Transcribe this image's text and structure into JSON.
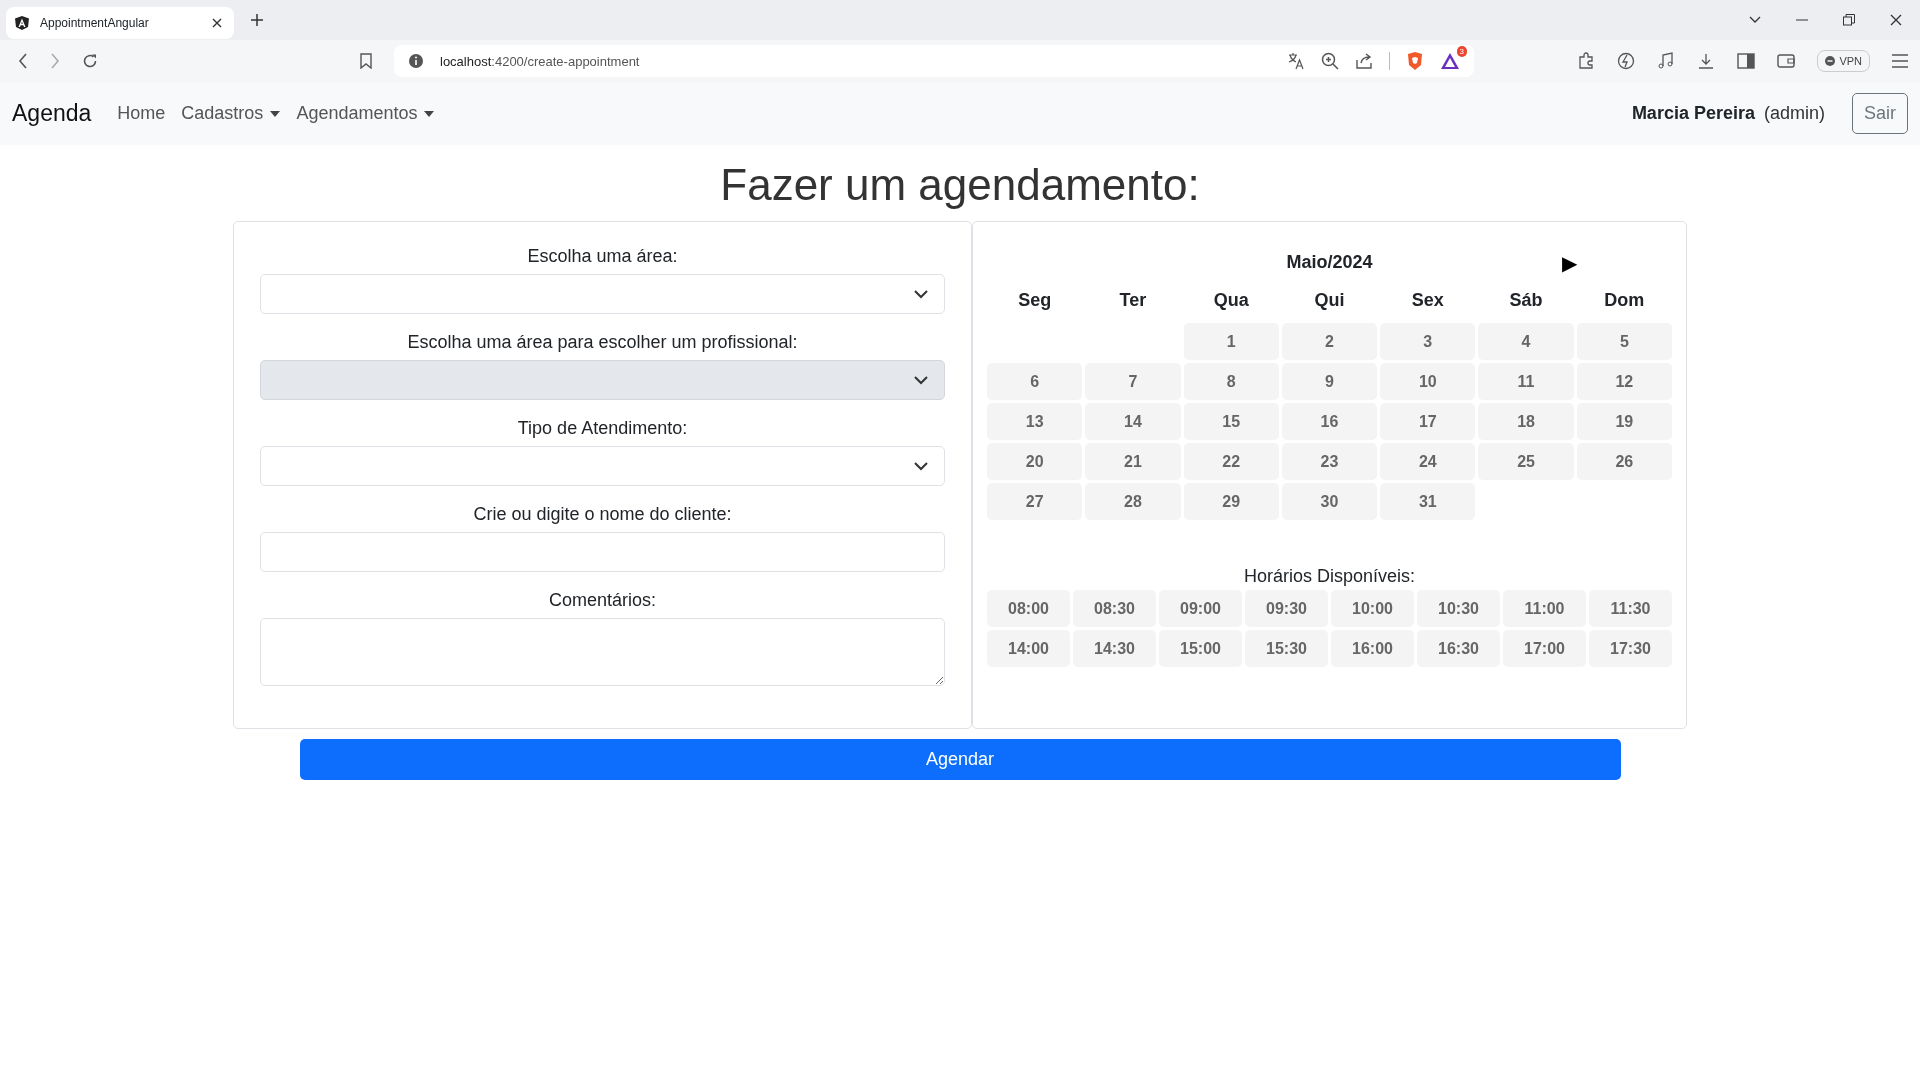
{
  "browser": {
    "tab_title": "AppointmentAngular",
    "url_host": "localhost",
    "url_rest": ":4200/create-appointment",
    "rewards_badge": "3",
    "vpn_label": "VPN"
  },
  "navbar": {
    "brand": "Agenda",
    "links": [
      {
        "label": "Home",
        "dropdown": false
      },
      {
        "label": "Cadastros",
        "dropdown": true
      },
      {
        "label": "Agendamentos",
        "dropdown": true
      }
    ],
    "user_name": "Marcia Pereira",
    "user_role": "(admin)",
    "logout": "Sair"
  },
  "title": "Fazer um agendamento:",
  "form": [
    {
      "kind": "select",
      "label": "Escolha uma área:",
      "disabled": false
    },
    {
      "kind": "select",
      "label": "Escolha uma área para escolher um profissional:",
      "disabled": true
    },
    {
      "kind": "select",
      "label": "Tipo de Atendimento:",
      "disabled": false
    },
    {
      "kind": "input",
      "label": "Crie ou digite o nome do cliente:",
      "disabled": false
    },
    {
      "kind": "textarea",
      "label": "Comentários:",
      "disabled": false
    }
  ],
  "calendar": {
    "month": "Maio/2024",
    "next": "▶",
    "weekdays": [
      "Seg",
      "Ter",
      "Qua",
      "Qui",
      "Sex",
      "Sáb",
      "Dom"
    ],
    "weeks": [
      {
        "kind": "first",
        "days": [
          "1",
          "2",
          "3",
          "4",
          "5"
        ]
      },
      {
        "kind": "full",
        "days": [
          "6",
          "7",
          "8",
          "9",
          "10",
          "11",
          "12"
        ]
      },
      {
        "kind": "full",
        "days": [
          "13",
          "14",
          "15",
          "16",
          "17",
          "18",
          "19"
        ]
      },
      {
        "kind": "full",
        "days": [
          "20",
          "21",
          "22",
          "23",
          "24",
          "25",
          "26"
        ]
      },
      {
        "kind": "last",
        "days": [
          "27",
          "28",
          "29",
          "30",
          "31"
        ]
      }
    ],
    "times_label": "Horários Disponíveis:",
    "times": [
      "08:00",
      "08:30",
      "09:00",
      "09:30",
      "10:00",
      "10:30",
      "11:00",
      "11:30",
      "14:00",
      "14:30",
      "15:00",
      "15:30",
      "16:00",
      "16:30",
      "17:00",
      "17:30"
    ]
  },
  "submit": "Agendar"
}
